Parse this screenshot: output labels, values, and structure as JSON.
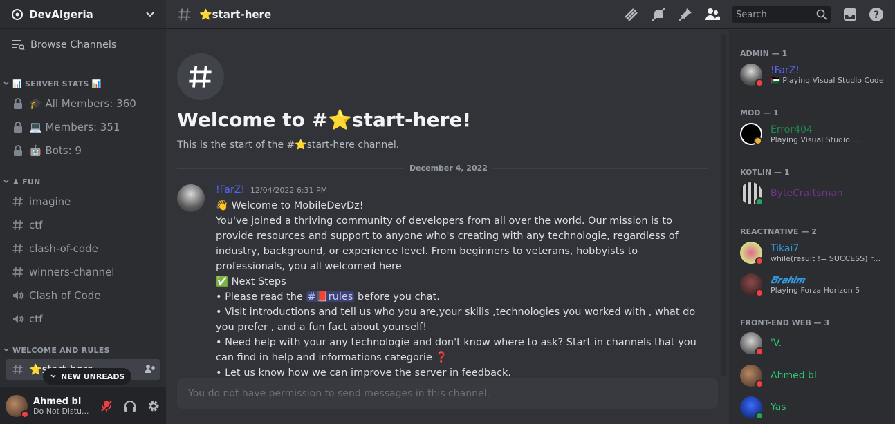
{
  "server": {
    "name": "DevAlgeria"
  },
  "nav": {
    "browse_channels": "Browse Channels"
  },
  "categories": {
    "stats": "📊 SERVER STATS 📊",
    "fun": "♟ FUN",
    "welcome": "WELCOME AND RULES"
  },
  "stats_channels": [
    {
      "label": "🎓 All Members: 360"
    },
    {
      "label": "💻 Members: 351"
    },
    {
      "label": "🤖 Bots: 9"
    }
  ],
  "fun_channels": [
    {
      "label": "imagine",
      "type": "text"
    },
    {
      "label": "ctf",
      "type": "text"
    },
    {
      "label": "clash-of-code",
      "type": "text"
    },
    {
      "label": "winners-channel",
      "type": "text"
    },
    {
      "label": "Clash of Code",
      "type": "voice"
    },
    {
      "label": "ctf",
      "type": "voice"
    }
  ],
  "active_channel": {
    "label": "⭐start-here"
  },
  "new_unreads": "NEW UNREADS",
  "user": {
    "name": "Ahmed bl",
    "status": "Do Not Distu..."
  },
  "topbar": {
    "channel": "⭐start-here",
    "search_placeholder": "Search"
  },
  "welcome": {
    "title": "Welcome to #⭐start-here!",
    "subtitle": "This is the start of the #⭐start-here channel."
  },
  "date_divider": "December 4, 2022",
  "message": {
    "author": "!FarZ!",
    "timestamp": "12/04/2022 6:31 PM",
    "lines": {
      "greeting": "👋 Welcome to MobileDevDz!",
      "intro": "You've joined a thriving community of developers from all over the world. Our mission is to provide resources and support to anyone who's creating with any technologie, regardless of industry, background, or experience level. From beginners to veterans, hobbyists to professionals, you all welcomed here",
      "next_steps": "✅ Next Steps",
      "step1_pre": "• Please read the ",
      "step1_mention": "#📕rules",
      "step1_post": " before you chat.",
      "step2": "• Visit introductions and tell us who you are,your skills ,technologies you worked with , what do you prefer , and a fun fact about yourself!",
      "step3": "• Need help with your any  technologie  and don't know where to ask? Start in channels that  you can find  in help and informations categorie ❓",
      "step4": "• Let us know how we can improve the server in feedback."
    }
  },
  "composer": {
    "placeholder": "You do not have permission to send messages in this channel."
  },
  "member_groups": [
    {
      "title": "ADMIN — 1",
      "members": [
        {
          "name": "!FarZ!",
          "activity": "🇵🇸 Playing Visual Studio Code",
          "color": "#5865f2"
        }
      ]
    },
    {
      "title": "MOD — 1",
      "members": [
        {
          "name": "Error404",
          "activity": "Playing Visual Studio ...",
          "color": "#1f8b4c"
        }
      ]
    },
    {
      "title": "KOTLIN — 1",
      "members": [
        {
          "name": "ByteCraftsman",
          "activity": "",
          "color": "#71368a"
        }
      ]
    },
    {
      "title": "REACTNATIVE — 2",
      "members": [
        {
          "name": "Tikai7",
          "activity": "while(result != SUCCESS) resu...",
          "color": "#3498db"
        },
        {
          "name": "𝑩𝒓𝒂𝒉𝒊𝒎",
          "activity": "Playing Forza Horizon 5",
          "color": "#3498db"
        }
      ]
    },
    {
      "title": "FRONT-END WEB — 3",
      "members": [
        {
          "name": "'V.",
          "activity": "",
          "color": "#2ecc71"
        },
        {
          "name": "Ahmed bl",
          "activity": "",
          "color": "#2ecc71"
        },
        {
          "name": "Yas",
          "activity": "",
          "color": "#2ecc71"
        }
      ]
    }
  ]
}
